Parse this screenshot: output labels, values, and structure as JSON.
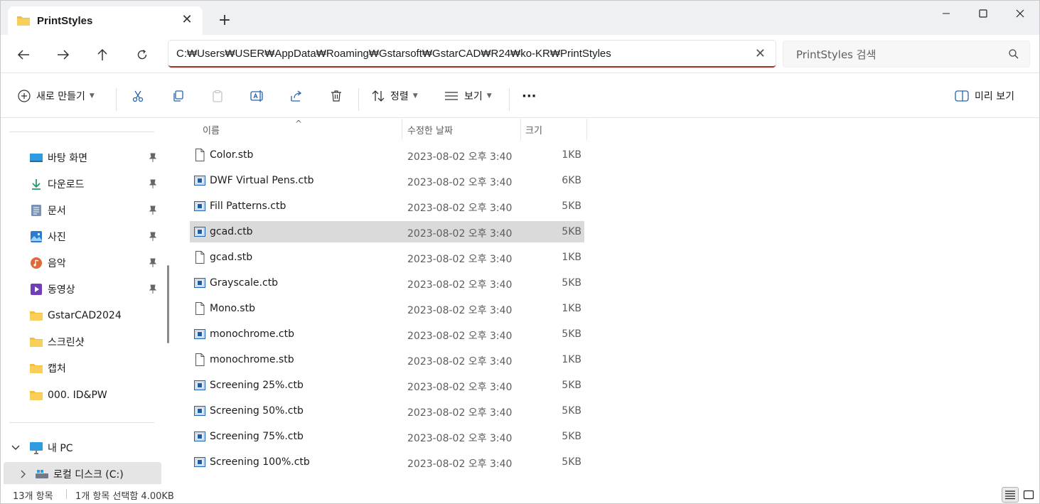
{
  "tab": {
    "title": "PrintStyles",
    "close": "✕",
    "new": "+"
  },
  "address": {
    "path": "C:₩Users₩USER₩AppData₩Roaming₩Gstarsoft₩GstarCAD₩R24₩ko-KR₩PrintStyles",
    "clear": "✕"
  },
  "search": {
    "placeholder": "PrintStyles 검색"
  },
  "commands": {
    "new_label": "새로 만들기",
    "sort_label": "정렬",
    "view_label": "보기",
    "more": "···",
    "details_label": "미리 보기"
  },
  "sidebar": {
    "items": [
      {
        "label": "바탕 화면",
        "icon": "desktop-icon",
        "pinned": true
      },
      {
        "label": "다운로드",
        "icon": "download-icon",
        "pinned": true
      },
      {
        "label": "문서",
        "icon": "document-icon",
        "pinned": true
      },
      {
        "label": "사진",
        "icon": "picture-icon",
        "pinned": true
      },
      {
        "label": "음악",
        "icon": "music-icon",
        "pinned": true
      },
      {
        "label": "동영상",
        "icon": "video-icon",
        "pinned": true
      },
      {
        "label": "GstarCAD2024",
        "icon": "folder-icon",
        "pinned": false
      },
      {
        "label": "스크린샷",
        "icon": "folder-icon",
        "pinned": false
      },
      {
        "label": "캡처",
        "icon": "folder-icon",
        "pinned": false
      },
      {
        "label": "000. ID&PW",
        "icon": "folder-icon",
        "pinned": false
      }
    ],
    "pc": {
      "label": "내 PC",
      "icon": "computer-icon"
    },
    "drive": {
      "label": "로컬 디스크 (C:)",
      "icon": "drive-icon"
    }
  },
  "columns": {
    "name": "이름",
    "date": "수정한 날짜",
    "size": "크기"
  },
  "files": [
    {
      "name": "Color.stb",
      "date": "2023-08-02 오후 3:40",
      "size": "1KB",
      "type": "stb"
    },
    {
      "name": "DWF Virtual Pens.ctb",
      "date": "2023-08-02 오후 3:40",
      "size": "6KB",
      "type": "ctb"
    },
    {
      "name": "Fill Patterns.ctb",
      "date": "2023-08-02 오후 3:40",
      "size": "5KB",
      "type": "ctb"
    },
    {
      "name": "gcad.ctb",
      "date": "2023-08-02 오후 3:40",
      "size": "5KB",
      "type": "ctb",
      "selected": true
    },
    {
      "name": "gcad.stb",
      "date": "2023-08-02 오후 3:40",
      "size": "1KB",
      "type": "stb"
    },
    {
      "name": "Grayscale.ctb",
      "date": "2023-08-02 오후 3:40",
      "size": "5KB",
      "type": "ctb"
    },
    {
      "name": "Mono.stb",
      "date": "2023-08-02 오후 3:40",
      "size": "1KB",
      "type": "stb"
    },
    {
      "name": "monochrome.ctb",
      "date": "2023-08-02 오후 3:40",
      "size": "5KB",
      "type": "ctb"
    },
    {
      "name": "monochrome.stb",
      "date": "2023-08-02 오후 3:40",
      "size": "1KB",
      "type": "stb"
    },
    {
      "name": "Screening 25%.ctb",
      "date": "2023-08-02 오후 3:40",
      "size": "5KB",
      "type": "ctb"
    },
    {
      "name": "Screening 50%.ctb",
      "date": "2023-08-02 오후 3:40",
      "size": "5KB",
      "type": "ctb"
    },
    {
      "name": "Screening 75%.ctb",
      "date": "2023-08-02 오후 3:40",
      "size": "5KB",
      "type": "ctb"
    },
    {
      "name": "Screening 100%.ctb",
      "date": "2023-08-02 오후 3:40",
      "size": "5KB",
      "type": "ctb"
    }
  ],
  "status": {
    "count": "13개 항목",
    "selection": "1개 항목 선택함 4.00KB"
  },
  "colors": {
    "accent": "#9a3b30",
    "folder": "#f3bf3f",
    "selected_row": "#dadada"
  }
}
